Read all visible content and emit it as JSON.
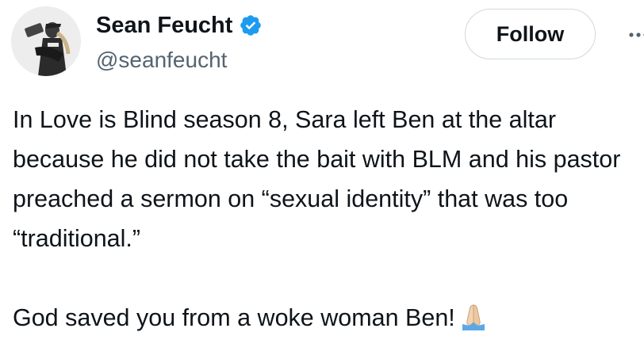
{
  "author": {
    "display_name": "Sean Feucht",
    "handle": "@seanfeucht",
    "verified": true,
    "verified_color": "#1d9bf0"
  },
  "actions": {
    "follow_label": "Follow",
    "more_icon": "more-options-icon"
  },
  "tweet": {
    "paragraph_1": "In Love is Blind season 8, Sara left Ben at the altar because he did not take the bait with BLM and his pastor preached a sermon on “sexual identity” that was too “traditional.”",
    "paragraph_2": "God saved you from a woke woman Ben!",
    "emoji": "folded-hands-icon"
  }
}
